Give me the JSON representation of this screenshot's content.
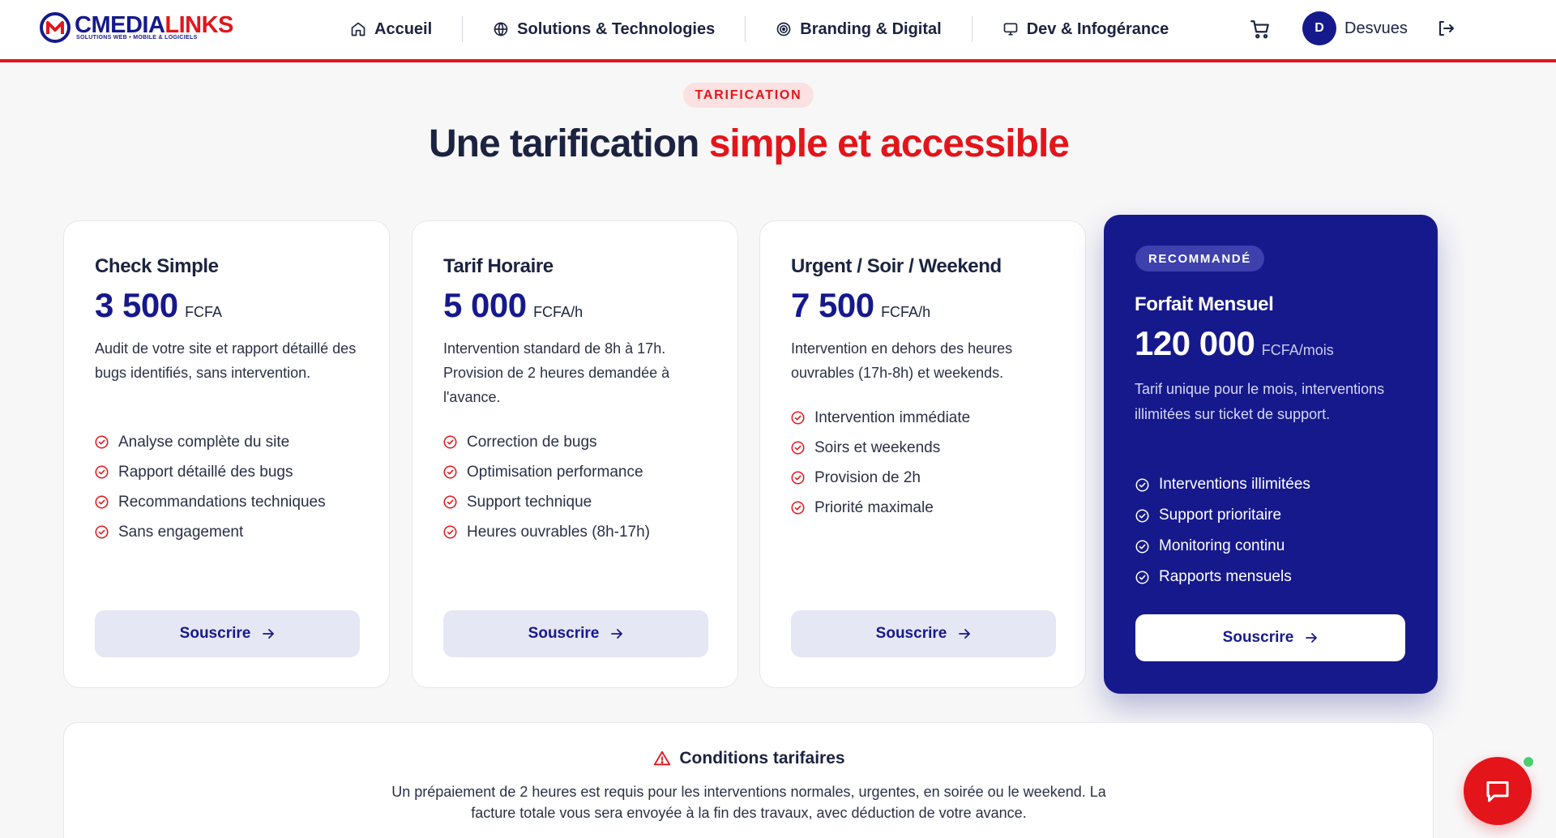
{
  "header": {
    "logo": {
      "brand_left": "CMEDIA",
      "brand_right": "LINKS",
      "tagline": "SOLUTIONS WEB • MOBILE & LOGICIELS"
    },
    "nav": [
      {
        "label": "Accueil",
        "icon": "home-icon"
      },
      {
        "label": "Solutions & Technologies",
        "icon": "globe-icon"
      },
      {
        "label": "Branding & Digital",
        "icon": "target-icon"
      },
      {
        "label": "Dev & Infogérance",
        "icon": "monitor-icon"
      }
    ],
    "user": {
      "initial": "D",
      "name": "Desvues"
    }
  },
  "section": {
    "badge": "TARIFICATION",
    "title_plain": "Une tarification",
    "title_accent": "simple et accessible"
  },
  "plans": [
    {
      "name": "Check Simple",
      "price": "3 500",
      "unit": "FCFA",
      "description": "Audit de votre site et rapport détaillé des bugs identifiés, sans intervention.",
      "features": [
        "Analyse complète du site",
        "Rapport détaillé des bugs",
        "Recommandations techniques",
        "Sans engagement"
      ],
      "button": "Souscrire"
    },
    {
      "name": "Tarif Horaire",
      "price": "5 000",
      "unit": "FCFA/h",
      "description": "Intervention standard de 8h à 17h. Provision de 2 heures demandée à l'avance.",
      "features": [
        "Correction de bugs",
        "Optimisation performance",
        "Support technique",
        "Heures ouvrables (8h-17h)"
      ],
      "button": "Souscrire"
    },
    {
      "name": "Urgent / Soir / Weekend",
      "price": "7 500",
      "unit": "FCFA/h",
      "description": "Intervention en dehors des heures ouvrables (17h-8h) et weekends.",
      "features": [
        "Intervention immédiate",
        "Soirs et weekends",
        "Provision de 2h",
        "Priorité maximale"
      ],
      "button": "Souscrire"
    },
    {
      "badge": "RECOMMANDÉ",
      "name": "Forfait Mensuel",
      "price": "120 000",
      "unit": "FCFA/mois",
      "description": "Tarif unique pour le mois, interventions illimitées sur ticket de support.",
      "features": [
        "Interventions illimitées",
        "Support prioritaire",
        "Monitoring continu",
        "Rapports mensuels"
      ],
      "button": "Souscrire"
    }
  ],
  "conditions": {
    "title": "Conditions tarifaires",
    "text": "Un prépaiement de 2 heures est requis pour les interventions normales, urgentes, en soirée ou le weekend. La facture totale vous sera envoyée à la fin des travaux, avec déduction de votre avance."
  },
  "colors": {
    "primary": "#16198c",
    "accent": "#e3151a",
    "online": "#4ccf6e"
  }
}
